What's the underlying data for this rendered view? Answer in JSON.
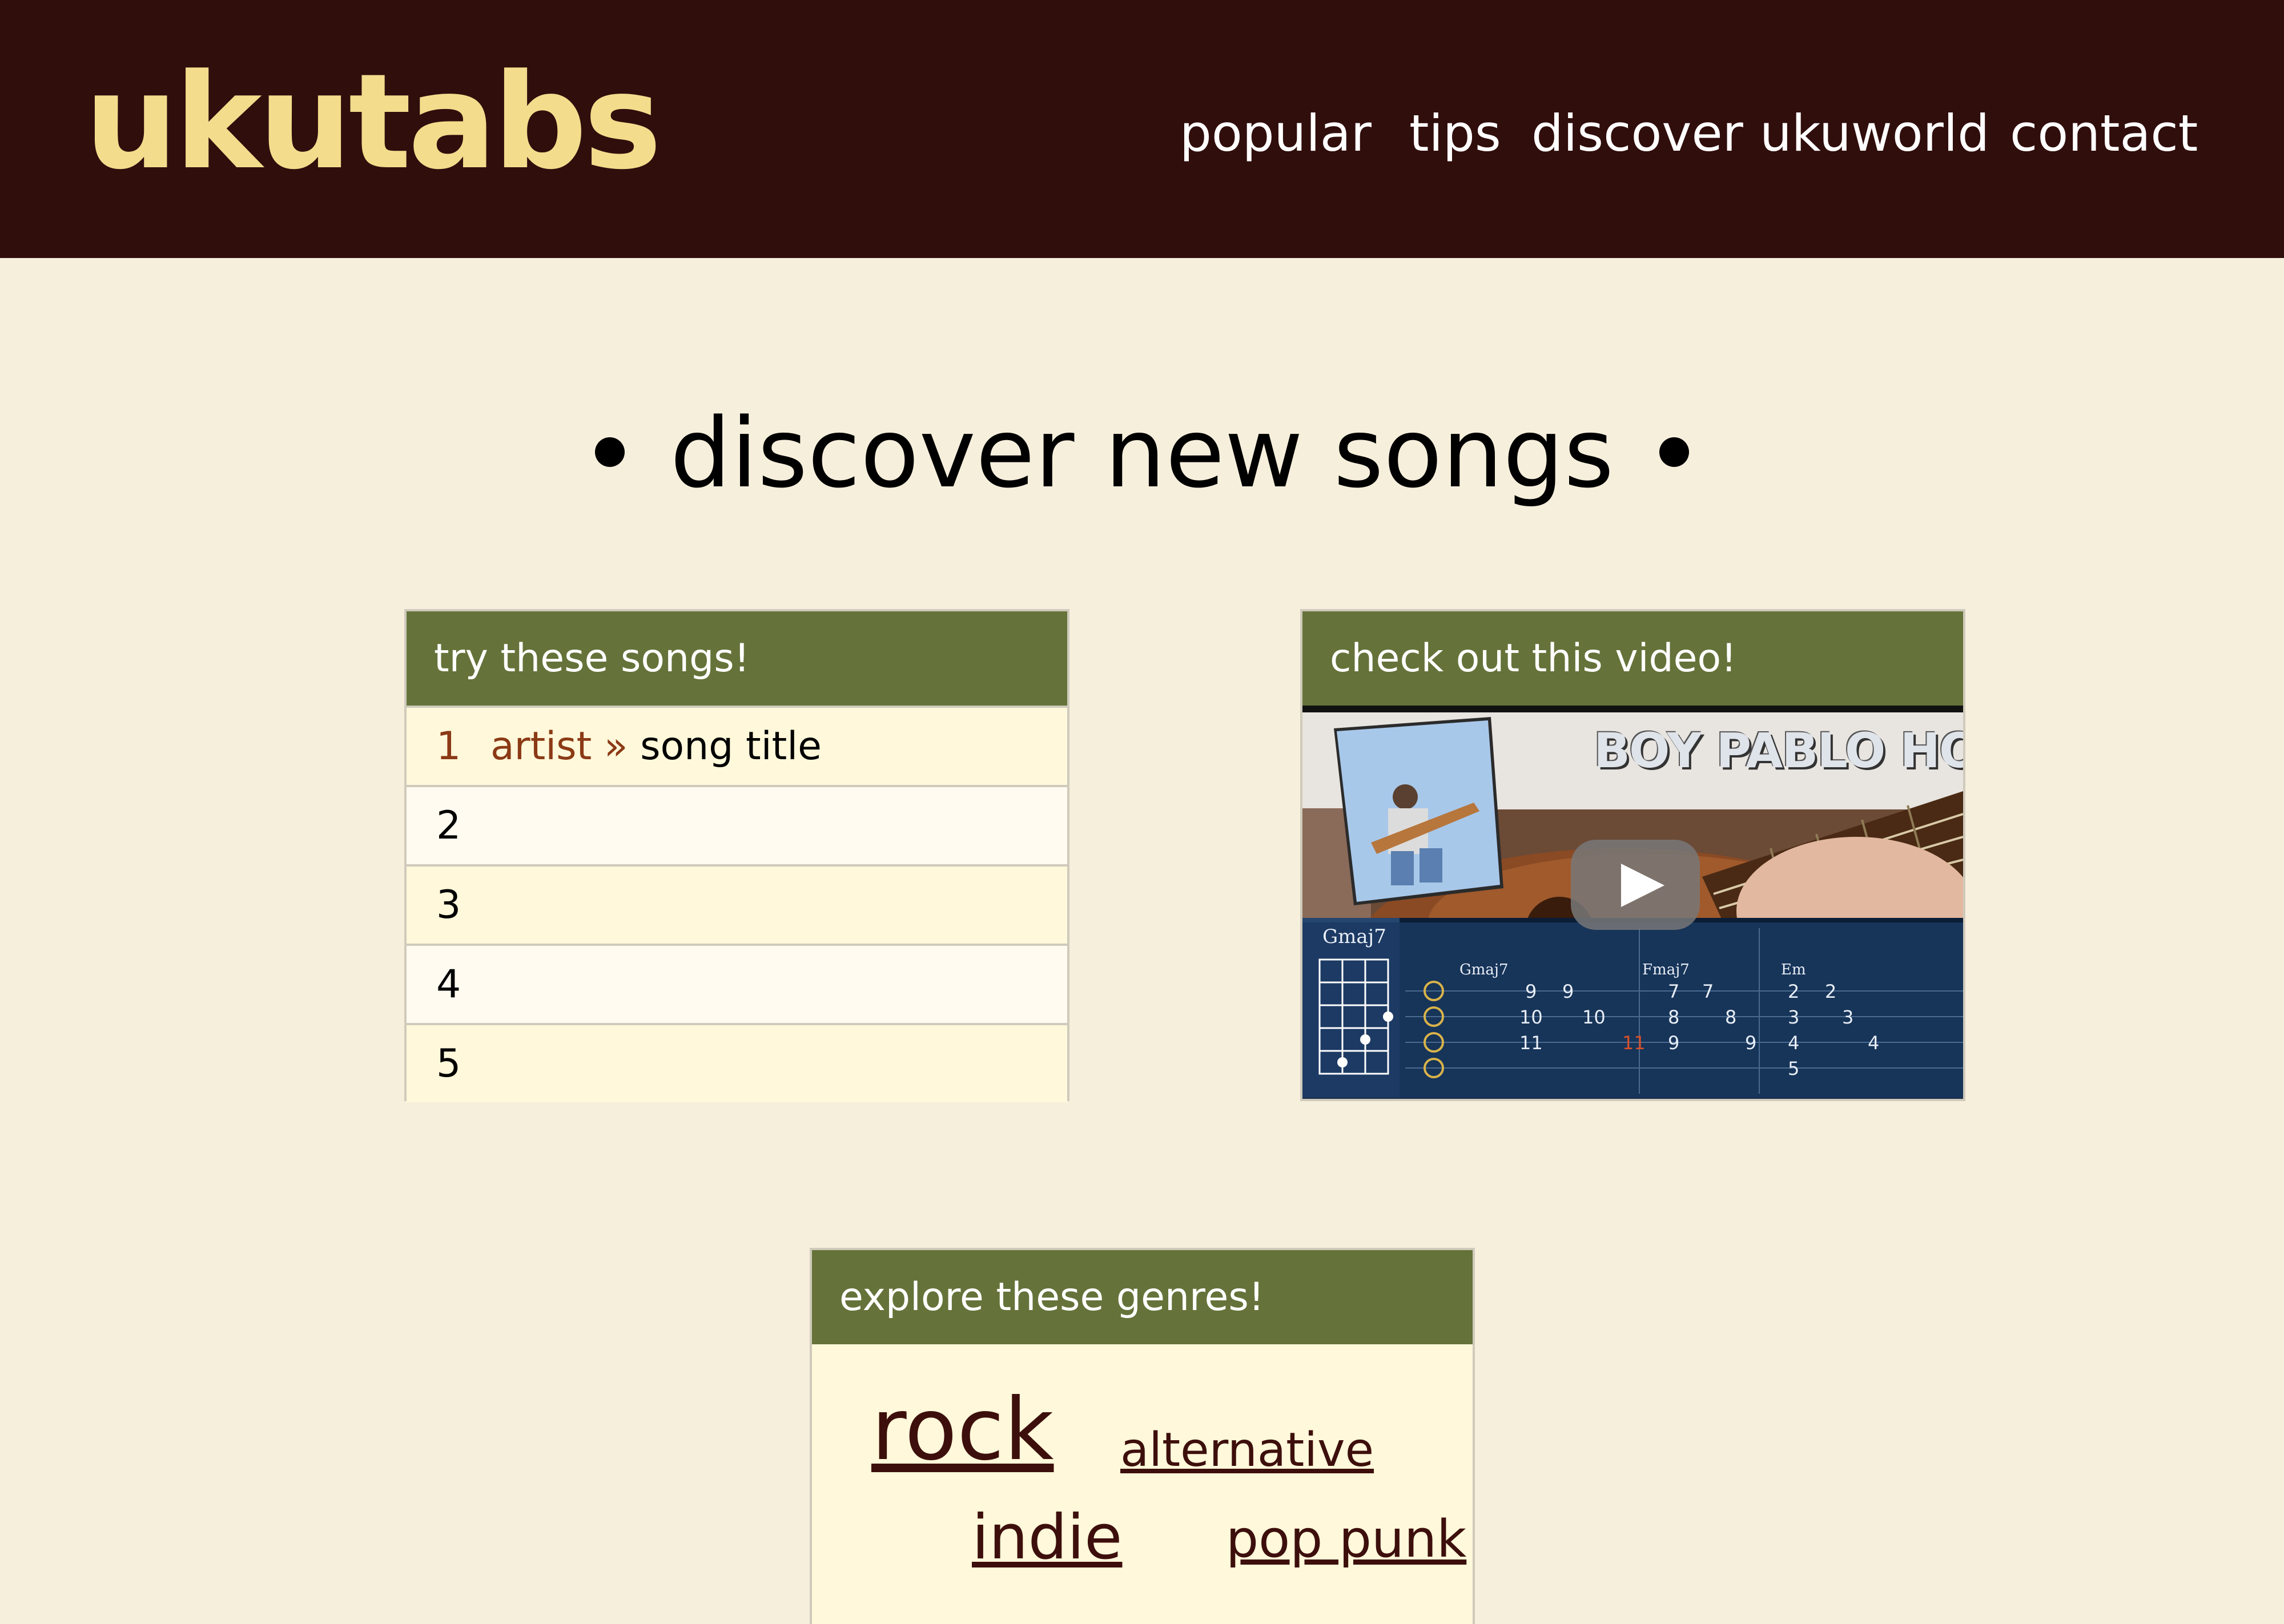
{
  "header": {
    "logo": "ukutabs",
    "nav": [
      "popular",
      "tips",
      "discover",
      "ukuworld",
      "contact"
    ]
  },
  "main": {
    "headline": "discover new songs",
    "songs_panel": {
      "title": "try these songs!",
      "rows": [
        {
          "rank": "1",
          "artist": "artist »",
          "song": "song title"
        },
        {
          "rank": "2",
          "artist": "",
          "song": ""
        },
        {
          "rank": "3",
          "artist": "",
          "song": ""
        },
        {
          "rank": "4",
          "artist": "",
          "song": ""
        },
        {
          "rank": "5",
          "artist": "",
          "song": ""
        }
      ]
    },
    "video_panel": {
      "title": "check out this video!",
      "video_overlay_text": "BOY PABLO HONEY",
      "chord_labels": [
        "Gmaj7",
        "Gmaj7",
        "Fmaj7",
        "Em"
      ]
    },
    "genres_panel": {
      "title": "explore these genres!",
      "genres": [
        "rock",
        "alternative",
        "indie",
        "pop punk"
      ]
    }
  },
  "colors": {
    "header_bg": "#300e0c",
    "logo": "#f3dc8c",
    "page_bg": "#f6efdc",
    "panel_head": "#65733a",
    "accent_link": "#8b3a16",
    "genre_link": "#3d0f0c"
  }
}
